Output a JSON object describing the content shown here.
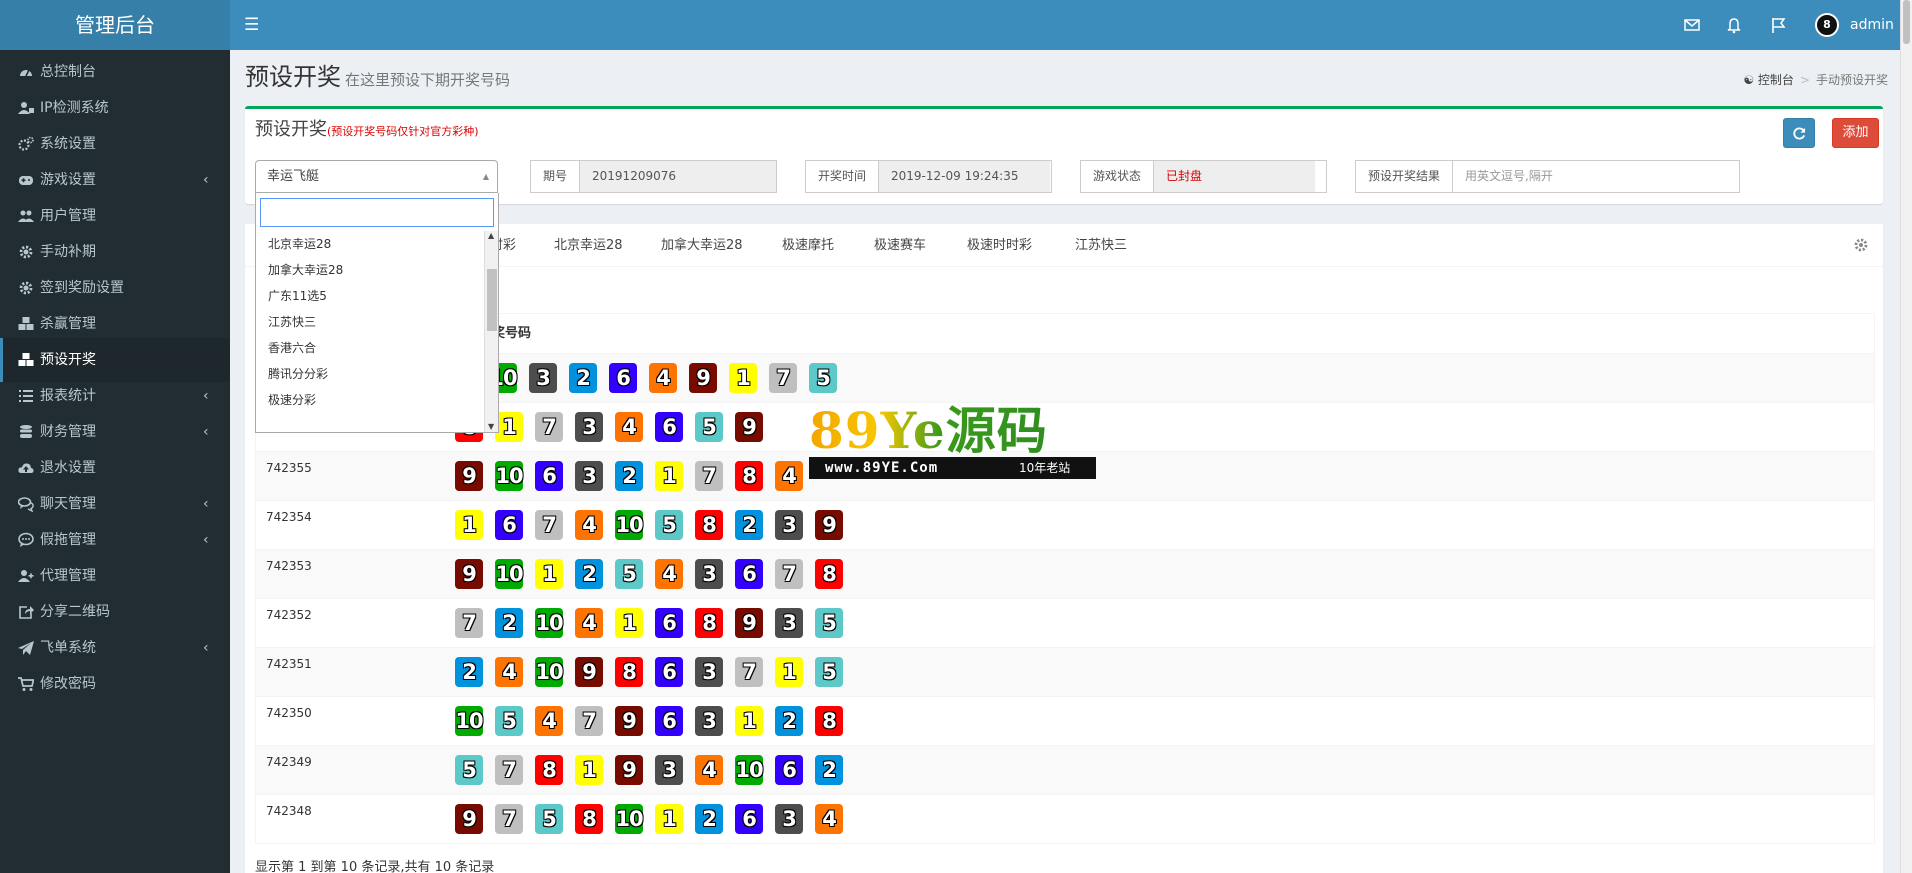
{
  "header": {
    "logo": "管理后台",
    "menu_icon": "bars-icon",
    "icons": [
      "mail-icon",
      "bell-icon",
      "flag-icon"
    ],
    "avatar_text": "8",
    "username": "admin",
    "color": "#3c8dbc"
  },
  "sidebar": {
    "items": [
      {
        "label": "总控制台",
        "icon": "dashboard-icon",
        "arrow": false
      },
      {
        "label": "IP检测系统",
        "icon": "user-ip-icon",
        "arrow": false
      },
      {
        "label": "系统设置",
        "icon": "cogs-icon",
        "arrow": false
      },
      {
        "label": "游戏设置",
        "icon": "gamepad-icon",
        "arrow": true
      },
      {
        "label": "用户管理",
        "icon": "users-icon",
        "arrow": false
      },
      {
        "label": "手动补期",
        "icon": "gear-icon",
        "arrow": false
      },
      {
        "label": "签到奖励设置",
        "icon": "gear-icon",
        "arrow": false
      },
      {
        "label": "杀赢管理",
        "icon": "cubes-icon",
        "arrow": false
      },
      {
        "label": "预设开奖",
        "icon": "cubes-icon",
        "arrow": false,
        "active": true
      },
      {
        "label": "报表统计",
        "icon": "list-icon",
        "arrow": true
      },
      {
        "label": "财务管理",
        "icon": "database-icon",
        "arrow": true
      },
      {
        "label": "退水设置",
        "icon": "cloud-upload-icon",
        "arrow": false
      },
      {
        "label": "聊天管理",
        "icon": "comments-icon",
        "arrow": true
      },
      {
        "label": "假拖管理",
        "icon": "comment-dots-icon",
        "arrow": true
      },
      {
        "label": "代理管理",
        "icon": "user-plus-icon",
        "arrow": false
      },
      {
        "label": "分享二维码",
        "icon": "share-square-icon",
        "arrow": false
      },
      {
        "label": "飞单系统",
        "icon": "paper-plane-icon",
        "arrow": true
      },
      {
        "label": "修改密码",
        "icon": "cart-icon",
        "arrow": false
      }
    ]
  },
  "page": {
    "title": "预设开奖",
    "subtitle": "在这里预设下期开奖号码",
    "breadcrumb": {
      "home": "控制台",
      "current": "手动预设开奖"
    }
  },
  "preset": {
    "title": "预设开奖",
    "note": "(预设开奖号码仅针对官方彩种)",
    "refresh_icon": "refresh-icon",
    "add_label": "添加",
    "game_select": "幸运飞艇",
    "period_label": "期号",
    "period_value": "20191209076",
    "time_label": "开奖时间",
    "time_value": "2019-12-09 19:24:35",
    "status_label": "游戏状态",
    "status_value": "已封盘",
    "result_label": "预设开奖结果",
    "result_placeholder": "用英文逗号,隔开"
  },
  "dropdown": {
    "options": [
      "北京幸运28",
      "加拿大幸运28",
      "广东11选5",
      "江苏快三",
      "香港六合",
      "腾讯分分彩",
      "极速分彩"
    ],
    "scrollbar": {
      "thumb_fraction": 0.3
    }
  },
  "tabs": {
    "items": [
      "时彩",
      "北京幸运28",
      "加拿大幸运28",
      "极速摩托",
      "极速赛车",
      "极速时时彩",
      "江苏快三"
    ],
    "settings_icon": "gear-icon"
  },
  "results": {
    "column_header": "奖号码",
    "rows": [
      {
        "id": "",
        "balls": [
          10,
          3,
          2,
          6,
          4,
          9,
          1,
          7,
          5
        ]
      },
      {
        "id": "",
        "balls": [
          8,
          1,
          7,
          3,
          4,
          6,
          5,
          9
        ]
      },
      {
        "id": "742355",
        "balls": [
          9,
          10,
          6,
          3,
          2,
          1,
          7,
          8,
          4
        ]
      },
      {
        "id": "742354",
        "balls": [
          1,
          6,
          7,
          4,
          10,
          5,
          8,
          2,
          3,
          9
        ]
      },
      {
        "id": "742353",
        "balls": [
          9,
          10,
          1,
          2,
          5,
          4,
          3,
          6,
          7,
          8
        ]
      },
      {
        "id": "742352",
        "balls": [
          7,
          2,
          10,
          4,
          1,
          6,
          8,
          9,
          3,
          5
        ]
      },
      {
        "id": "742351",
        "balls": [
          2,
          4,
          10,
          9,
          8,
          6,
          3,
          7,
          1,
          5
        ]
      },
      {
        "id": "742350",
        "balls": [
          10,
          5,
          4,
          7,
          9,
          6,
          3,
          1,
          2,
          8
        ]
      },
      {
        "id": "742349",
        "balls": [
          5,
          7,
          8,
          1,
          9,
          3,
          4,
          10,
          6,
          2
        ]
      },
      {
        "id": "742348",
        "balls": [
          9,
          7,
          5,
          8,
          10,
          1,
          2,
          6,
          3,
          4
        ]
      }
    ],
    "footer": "显示第 1 到第 10 条记录,共有 10 条记录"
  },
  "ball_colors": {
    "1": "#ffff00",
    "2": "#0092dd",
    "3": "#4d4d4d",
    "4": "#ff7300",
    "5": "#5cc8c8",
    "6": "#3300ff",
    "7": "#bfbfbf",
    "8": "#ff0000",
    "9": "#780b00",
    "10": "#00aa00"
  },
  "watermark": {
    "text": "89Ye源码",
    "url": "www.89YE.Com",
    "slogan": "10年老站"
  }
}
